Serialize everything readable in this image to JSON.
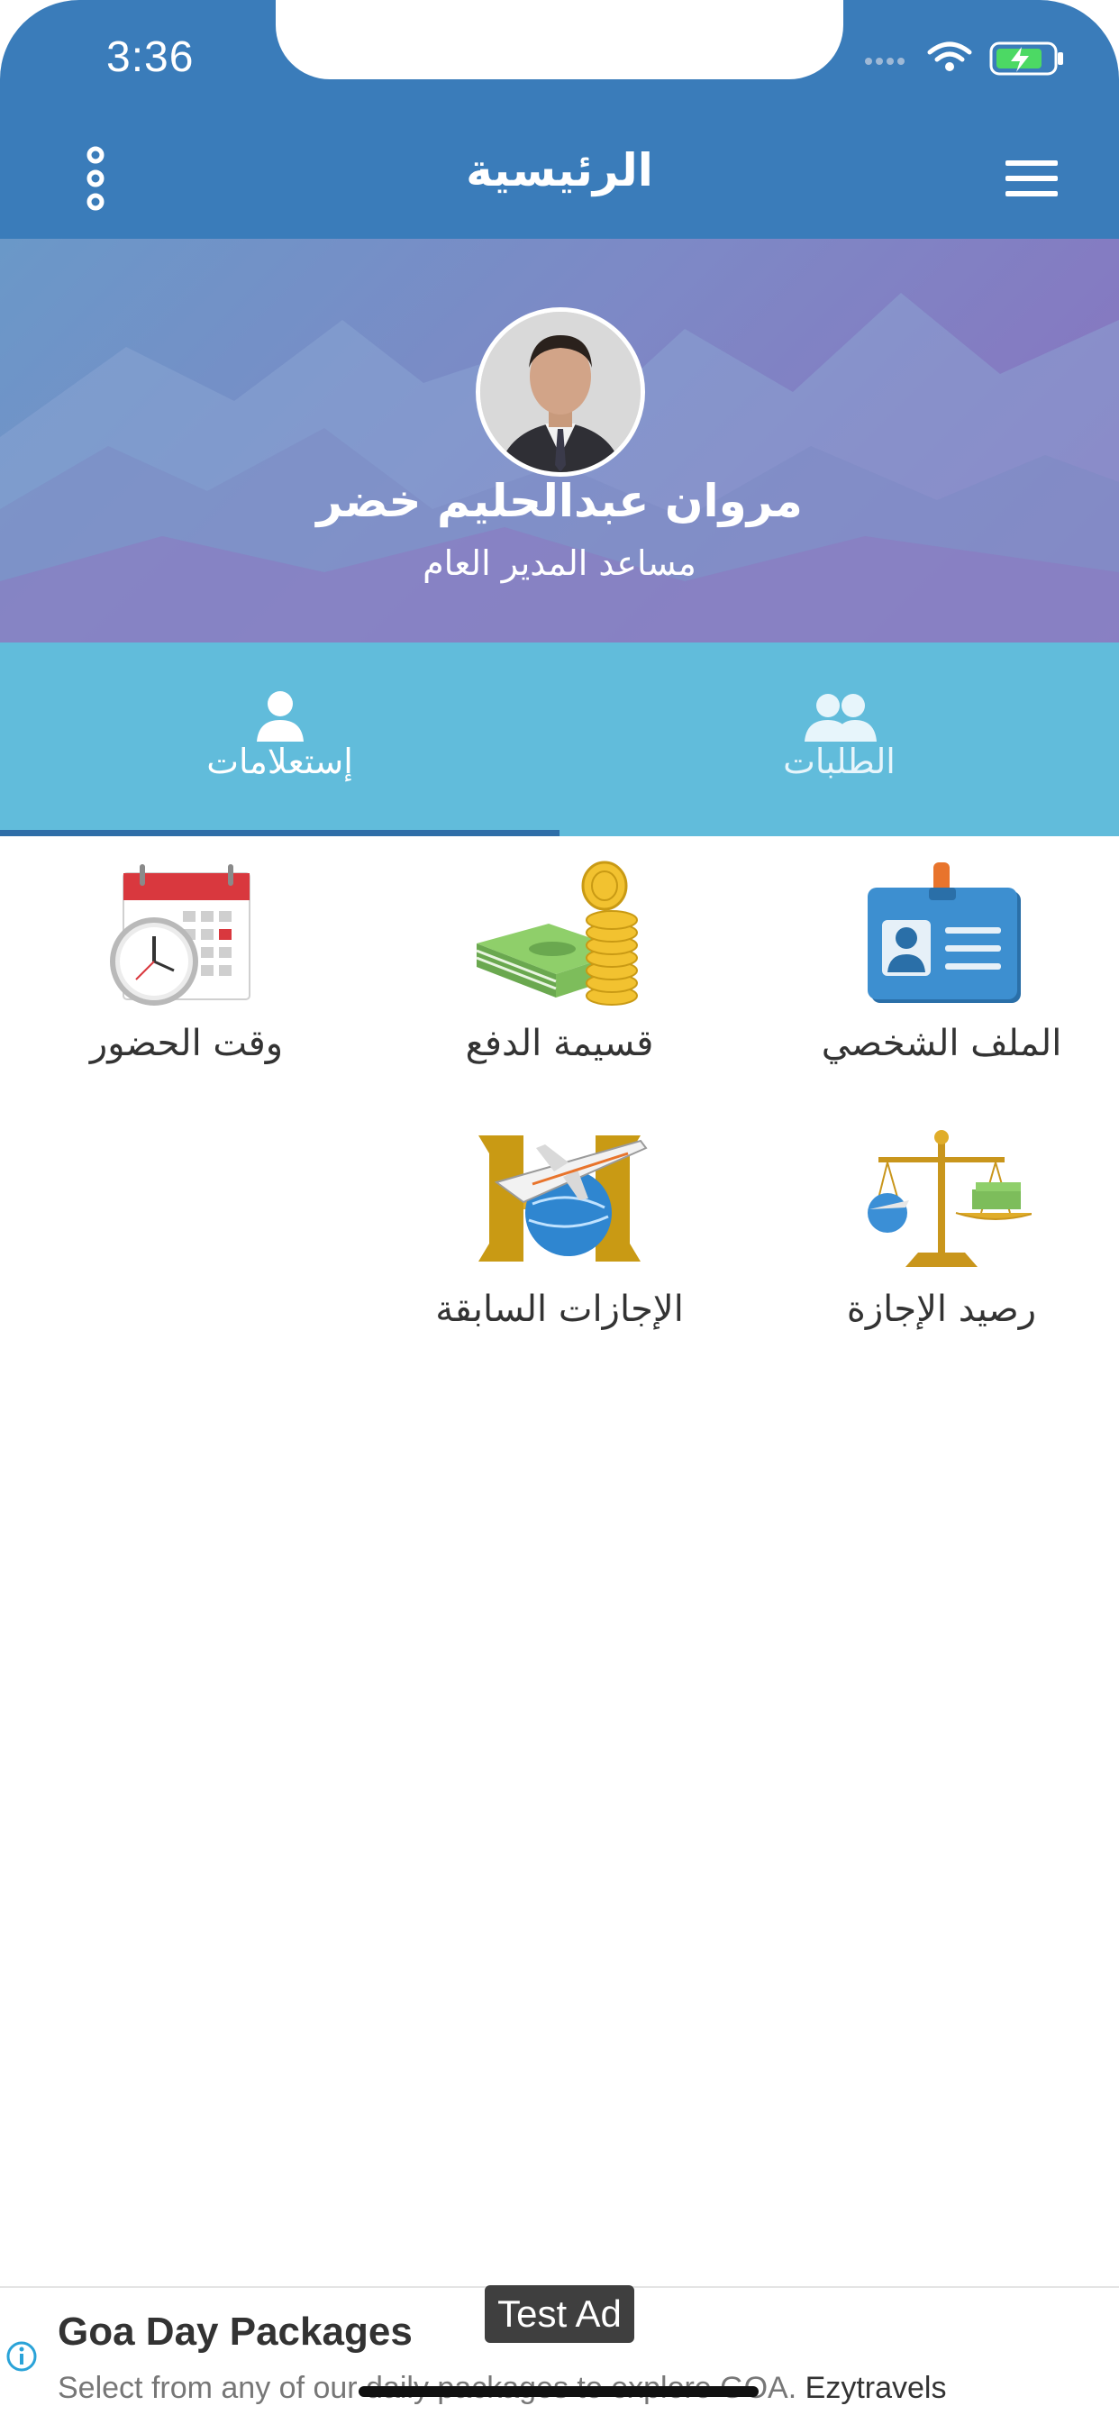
{
  "status": {
    "time": "3:36"
  },
  "appbar": {
    "title": "الرئيسية"
  },
  "profile": {
    "name": "مروان عبدالحليم خضر",
    "role": "مساعد المدير العام"
  },
  "tabs": [
    {
      "label": "إستعلامات",
      "icon": "person-icon",
      "selected": true
    },
    {
      "label": "الطلبات",
      "icon": "people-icon",
      "selected": false
    }
  ],
  "tiles": [
    {
      "label": "الملف الشخصي",
      "icon": "id-card-icon"
    },
    {
      "label": "قسيمة الدفع",
      "icon": "money-coins-icon"
    },
    {
      "label": "وقت الحضور",
      "icon": "calendar-clock-icon"
    },
    {
      "label": "رصيد الإجازة",
      "icon": "balance-scale-icon"
    },
    {
      "label": "الإجازات السابقة",
      "icon": "travel-h-icon"
    }
  ],
  "ad": {
    "badge": "Test Ad",
    "title": "Goa Day Packages",
    "description": "Select from any of our daily packages to explore GOA.",
    "brand": "Ezytravels"
  },
  "colors": {
    "appbar": "#3a7cba",
    "tabs": "#61bcdb",
    "indicator": "#2f6ea8"
  }
}
